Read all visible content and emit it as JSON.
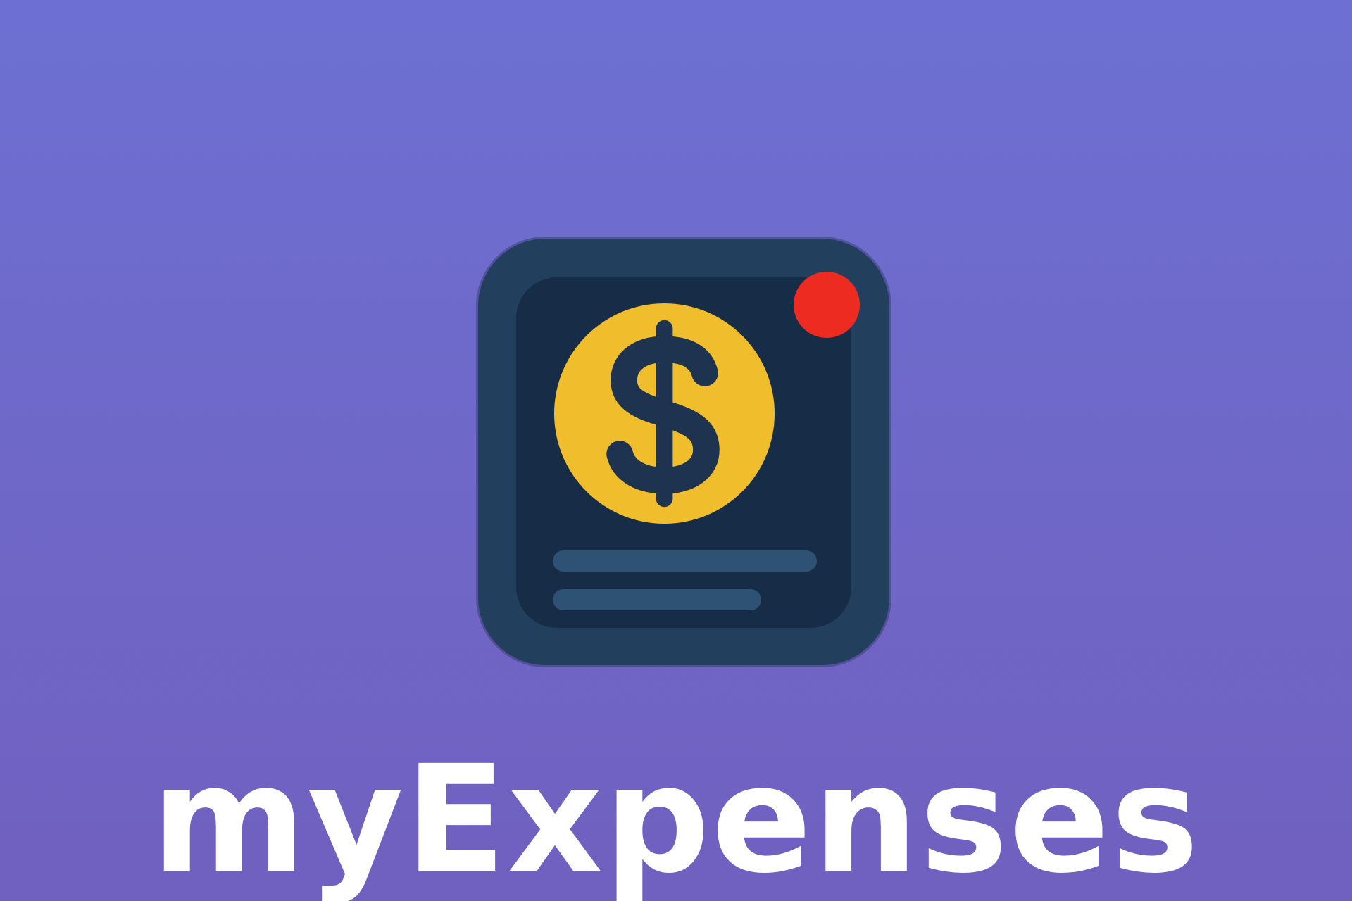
{
  "app": {
    "name": "myExpenses",
    "icon": "dollar-coin-receipt-icon"
  },
  "colors": {
    "background_top": "#6d70d2",
    "background_bottom": "#7060bf",
    "icon_frame": "#22405e",
    "icon_panel": "#172c46",
    "coin": "#f0bd2c",
    "dollar_sign": "#1e3350",
    "bars": "#2e5274",
    "notification_badge": "#ee2b20",
    "title_text": "#ffffff"
  },
  "icons": {
    "coin": "dollar-sign-icon",
    "badge": "notification-badge-icon"
  }
}
